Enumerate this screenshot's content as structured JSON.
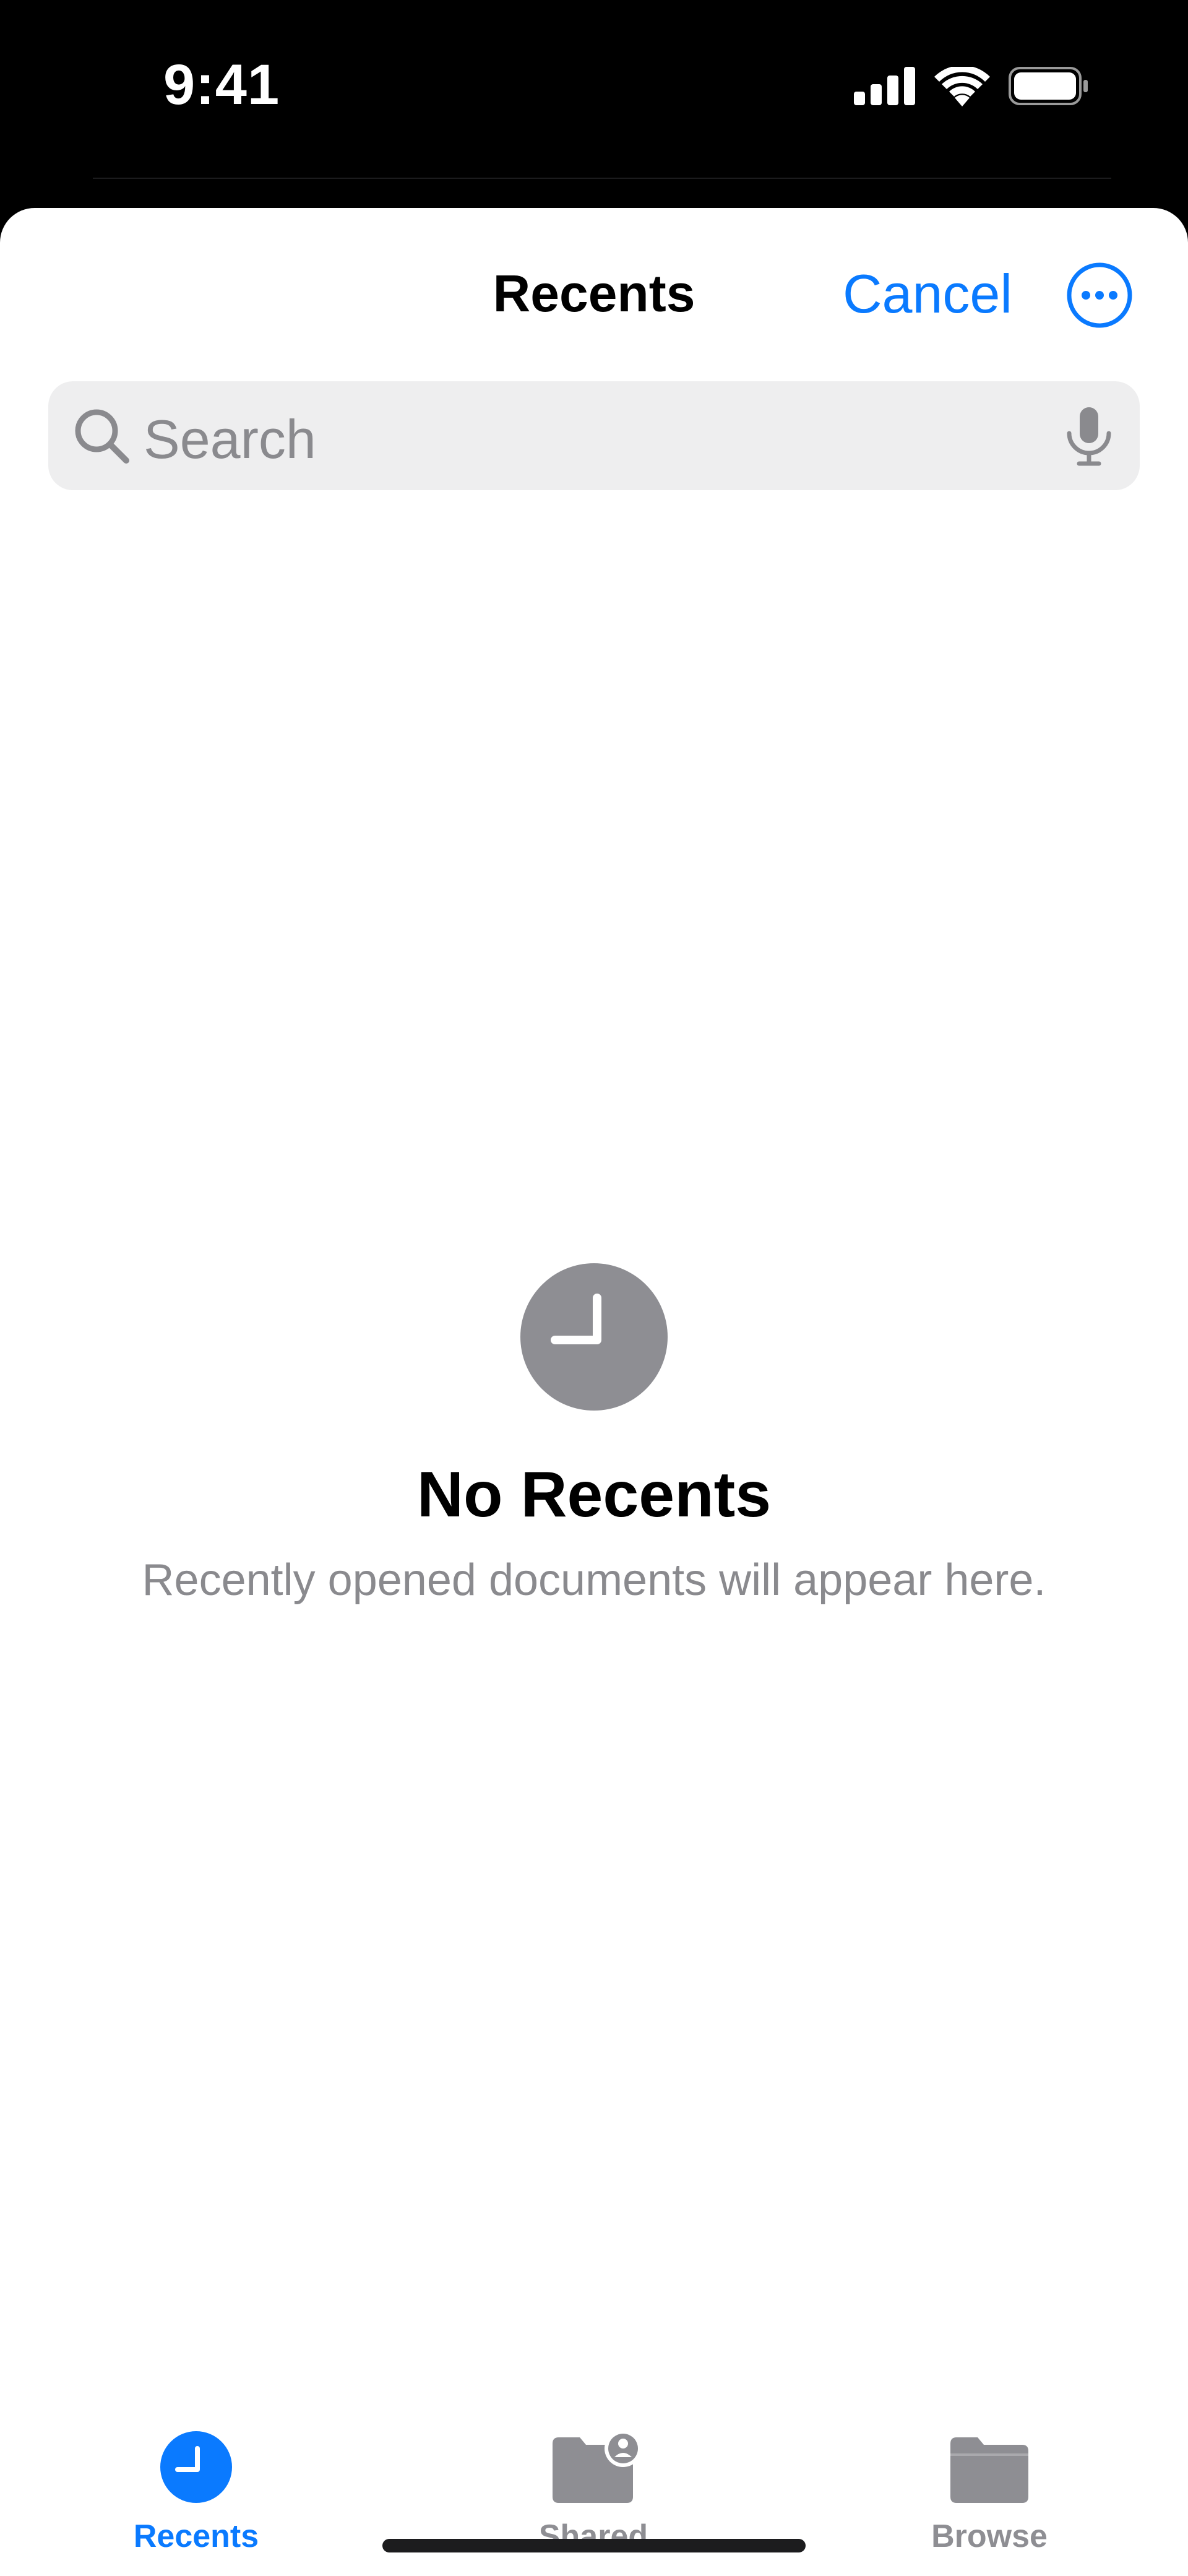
{
  "status_bar": {
    "time": "9:41",
    "icons": [
      "cellular-signal-icon",
      "wifi-icon",
      "battery-icon"
    ]
  },
  "nav": {
    "title": "Recents",
    "cancel_label": "Cancel",
    "more_icon": "ellipsis-circle-icon"
  },
  "search": {
    "placeholder": "Search",
    "icons": [
      "search-icon",
      "microphone-icon"
    ]
  },
  "empty_state": {
    "icon": "clock-icon",
    "title": "No Recents",
    "subtitle": "Recently opened documents will appear here."
  },
  "tabs": [
    {
      "label": "Recents",
      "icon": "clock-icon",
      "selected": true
    },
    {
      "label": "Shared",
      "icon": "shared-folder-icon",
      "selected": false
    },
    {
      "label": "Browse",
      "icon": "folder-icon",
      "selected": false
    }
  ],
  "colors": {
    "accent": "#0a7aff",
    "secondary_text": "#8a8a8e",
    "inactive_tab": "#8e8e93",
    "search_background": "#eeeeef"
  }
}
